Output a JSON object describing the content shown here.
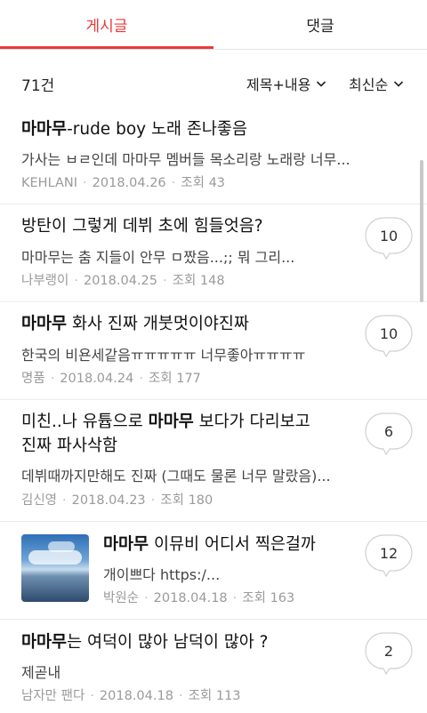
{
  "tabs": {
    "posts_label": "게시글",
    "comments_label": "댓글"
  },
  "toolbar": {
    "count": "71건",
    "search_scope": "제목+내용",
    "sort": "최신순"
  },
  "colors": {
    "accent": "#e83a3a",
    "meta": "#9a9a9a"
  },
  "posts": [
    {
      "title_pre": "",
      "title_bold": "마마무",
      "title_post": "-rude boy 노래 존나좋음",
      "title_line2": "",
      "body": "가사는 ㅂㄹ인데 마마무 멤버들 목소리랑 노래랑 너무...",
      "author": "KEHLANI",
      "date": "2018.04.26",
      "views": "조회 43",
      "comments": "",
      "has_thumb": false
    },
    {
      "title_pre": "방탄이 그렇게 데뷔 초에 힘들엇음?",
      "title_bold": "",
      "title_post": "",
      "title_line2": "",
      "body": "마마무는 춤 지들이 안무 ㅁ짰음...;; 뭐 그리...",
      "author": "나부랭이",
      "date": "2018.04.25",
      "views": "조회 148",
      "comments": "10",
      "has_thumb": false
    },
    {
      "title_pre": "",
      "title_bold": "마마무",
      "title_post": " 화사 진짜 개붓멋이야진짜",
      "title_line2": "",
      "body": "한국의 비욘세같음ㅠㅠㅠㅠㅠ 너무좋아ㅠㅠㅠㅠ",
      "author": "명품",
      "date": "2018.04.24",
      "views": "조회 177",
      "comments": "10",
      "has_thumb": false
    },
    {
      "title_pre": "미친..나 유튭으로 ",
      "title_bold": "마마무",
      "title_post": " 보다가 다리보고",
      "title_line2": "진짜 파사삭함",
      "body": "데뷔때까지만해도 진짜 (그때도 물론 너무 말랐음)...",
      "author": "김신영",
      "date": "2018.04.23",
      "views": "조회 180",
      "comments": "6",
      "has_thumb": false
    },
    {
      "title_pre": "",
      "title_bold": "마마무",
      "title_post": " 이뮤비 어디서 찍은걸까",
      "title_line2": "",
      "body": "개이쁘다 https:/...",
      "author": "박원순",
      "date": "2018.04.18",
      "views": "조회 163",
      "comments": "12",
      "has_thumb": true
    },
    {
      "title_pre": "",
      "title_bold": "마마무",
      "title_post": "는 여덕이 많아 남덕이 많아 ?",
      "title_line2": "",
      "body": "제곧내",
      "author": "남자만 팬다",
      "date": "2018.04.18",
      "views": "조회 113",
      "comments": "2",
      "has_thumb": false
    }
  ]
}
